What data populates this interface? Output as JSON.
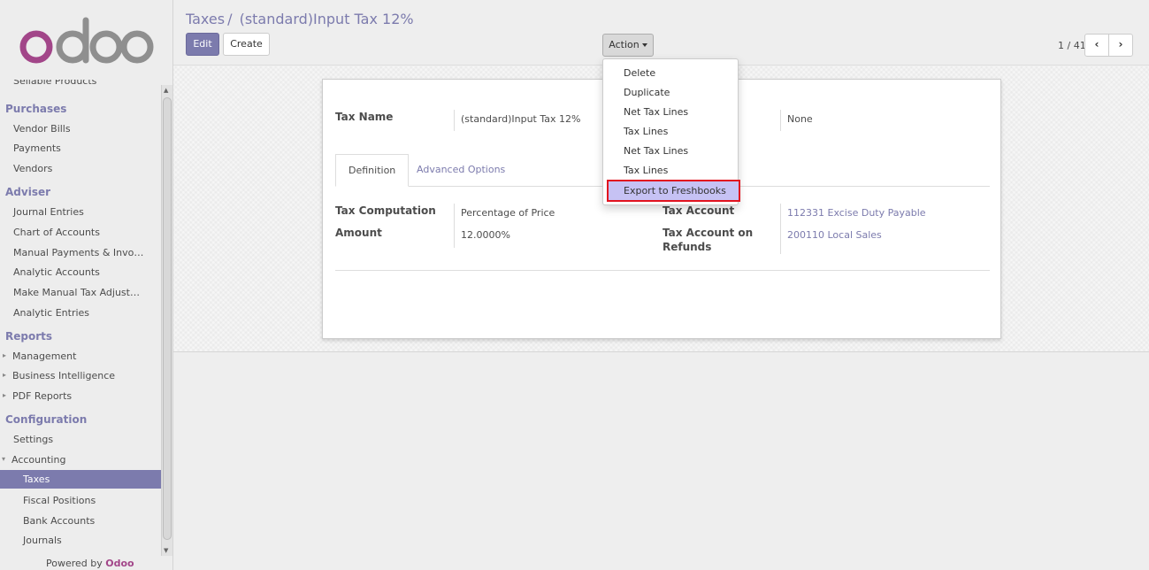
{
  "sidebar": {
    "cut_item": "Sellable Products",
    "purchases": "Purchases",
    "vendor_bills": "Vendor Bills",
    "payments": "Payments",
    "vendors": "Vendors",
    "adviser": "Adviser",
    "journal_entries": "Journal Entries",
    "chart_of_accounts": "Chart of Accounts",
    "manual_payments": "Manual Payments & Invo…",
    "analytic_accounts": "Analytic Accounts",
    "manual_tax": "Make Manual Tax Adjust…",
    "analytic_entries": "Analytic Entries",
    "reports": "Reports",
    "management": "Management",
    "business_intelligence": "Business Intelligence",
    "pdf_reports": "PDF Reports",
    "configuration": "Configuration",
    "settings": "Settings",
    "accounting": "Accounting",
    "taxes": "Taxes",
    "fiscal_positions": "Fiscal Positions",
    "bank_accounts": "Bank Accounts",
    "journals": "Journals",
    "powered_by": "Powered by",
    "powered_brand": "Odoo"
  },
  "header": {
    "breadcrumb_parent": "Taxes",
    "breadcrumb_sep": "/",
    "breadcrumb_current": "(standard)Input Tax 12%",
    "edit_label": "Edit",
    "create_label": "Create",
    "action_label": "Action",
    "pager": "1 / 41"
  },
  "action_menu": [
    "Delete",
    "Duplicate",
    "Net Tax Lines",
    "Tax Lines",
    "Net Tax Lines",
    "Tax Lines",
    "Export to Freshbooks"
  ],
  "form": {
    "tax_name_label": "Tax Name",
    "tax_name_value": "(standard)Input Tax 12%",
    "scope_value": "None",
    "tabs": [
      "Definition",
      "Advanced Options"
    ],
    "tax_computation_label": "Tax Computation",
    "tax_computation_value": "Percentage of Price",
    "amount_label": "Amount",
    "amount_value": "12.0000%",
    "tax_account_label": "Tax Account",
    "tax_account_value": "112331 Excise Duty Payable",
    "tax_account_refunds_label_1": "Tax Account on",
    "tax_account_refunds_label_2": "Refunds",
    "tax_account_refunds_value": "200110 Local Sales"
  },
  "colors": {
    "accent": "#7c7bad",
    "brand": "#a24689",
    "highlight": "#c6c2f4",
    "highlight_border": "#e2131f"
  }
}
